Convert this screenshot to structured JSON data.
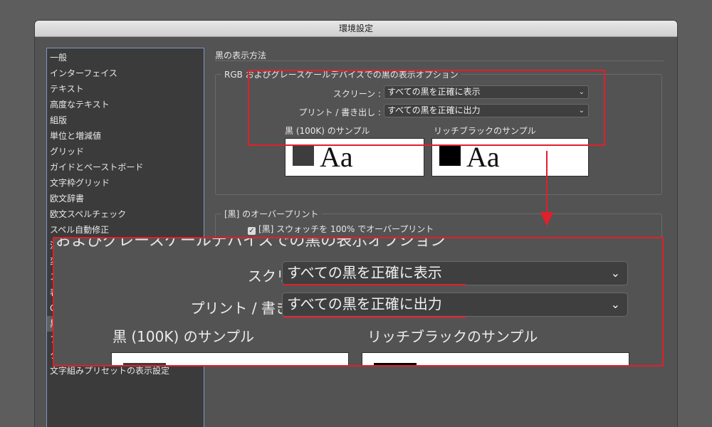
{
  "window": {
    "title": "環境設定"
  },
  "sidebar": {
    "items": [
      {
        "label": "一般"
      },
      {
        "label": "インターフェイス"
      },
      {
        "label": "テキスト"
      },
      {
        "label": "高度なテキスト"
      },
      {
        "label": "組版"
      },
      {
        "label": "単位と増減値"
      },
      {
        "label": "グリッド"
      },
      {
        "label": "ガイドとペーストボード"
      },
      {
        "label": "文字枠グリッド"
      },
      {
        "label": "欧文辞書"
      },
      {
        "label": "欧文スペルチェック"
      },
      {
        "label": "スペル自動修正"
      },
      {
        "label": "注"
      },
      {
        "label": "変"
      },
      {
        "label": "ス"
      },
      {
        "label": "表"
      },
      {
        "label": "G"
      },
      {
        "label": "黒"
      },
      {
        "label": "フ"
      },
      {
        "label": "ク"
      },
      {
        "label": "文字組みプリセットの表示設定"
      }
    ],
    "selected_index": 17
  },
  "main": {
    "section_title": "黒の表示方法",
    "rgb_group": {
      "legend": "RGB およびグレースケールデバイスでの黒の表示オプション",
      "screen_label": "スクリーン :",
      "screen_value": "すべての黒を正確に表示",
      "print_label": "プリント / 書き出し :",
      "print_value": "すべての黒を正確に出力",
      "sample_100k_label": "黒 (100K) のサンプル",
      "sample_rich_label": "リッチブラックのサンプル",
      "sample_text": "Aa",
      "swatch_100k_color": "#3d3d3d",
      "swatch_rich_color": "#000000"
    },
    "overprint_group": {
      "legend": "[黒] のオーバープリント",
      "checkbox_label": "[黒] スウォッチを 100% でオーバープリント",
      "checked": true
    }
  },
  "zoom": {
    "legend": "およびグレースケールデバイスでの黒の表示オプション",
    "screen_label": "スクリーン :",
    "screen_value": "すべての黒を正確に表示",
    "print_label": "プリント / 書き出し :",
    "print_value": "すべての黒を正確に出力",
    "sample_100k_label": "黒 (100K) のサンプル",
    "sample_rich_label": "リッチブラックのサンプル"
  },
  "icons": {
    "dropdown": "chevron-down-icon",
    "checkbox": "checkmark-icon",
    "annotation_arrow": "arrow-down-icon"
  },
  "colors": {
    "annotation": "#e0202a",
    "sidebar_border": "#7d97c4"
  }
}
